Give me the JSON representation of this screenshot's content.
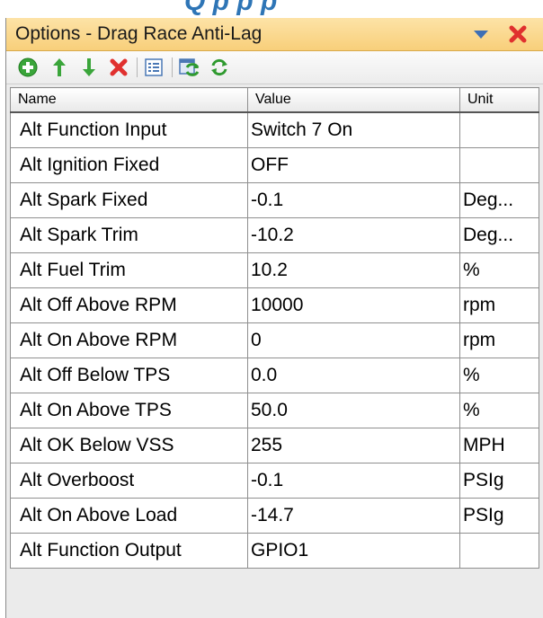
{
  "top_strip": {
    "clipped_text": "Q p p p"
  },
  "window": {
    "title": "Options - Drag Race Anti-Lag"
  },
  "toolbar": {
    "buttons": [
      "add-icon",
      "move-up-icon",
      "move-down-icon",
      "delete-icon",
      "list-icon",
      "refresh-table-icon",
      "refresh-icon"
    ]
  },
  "grid": {
    "columns": [
      "Name",
      "Value",
      "Unit"
    ],
    "rows": [
      {
        "name": "Alt Function Input",
        "value": "Switch 7 On",
        "unit": ""
      },
      {
        "name": "Alt Ignition Fixed",
        "value": "OFF",
        "unit": ""
      },
      {
        "name": "Alt Spark Fixed",
        "value": "-0.1",
        "unit": "Deg..."
      },
      {
        "name": "Alt Spark Trim",
        "value": "-10.2",
        "unit": "Deg..."
      },
      {
        "name": "Alt Fuel Trim",
        "value": "10.2",
        "unit": "%"
      },
      {
        "name": "Alt Off Above RPM",
        "value": "10000",
        "unit": "rpm"
      },
      {
        "name": "Alt On Above RPM",
        "value": "0",
        "unit": "rpm"
      },
      {
        "name": "Alt Off Below TPS",
        "value": "0.0",
        "unit": "%"
      },
      {
        "name": "Alt On Above TPS",
        "value": "50.0",
        "unit": "%"
      },
      {
        "name": "Alt OK Below VSS",
        "value": "255",
        "unit": "MPH"
      },
      {
        "name": "Alt Overboost",
        "value": "-0.1",
        "unit": "PSIg"
      },
      {
        "name": "Alt On Above Load",
        "value": "-14.7",
        "unit": "PSIg"
      },
      {
        "name": "Alt Function Output",
        "value": "GPIO1",
        "unit": ""
      }
    ]
  }
}
